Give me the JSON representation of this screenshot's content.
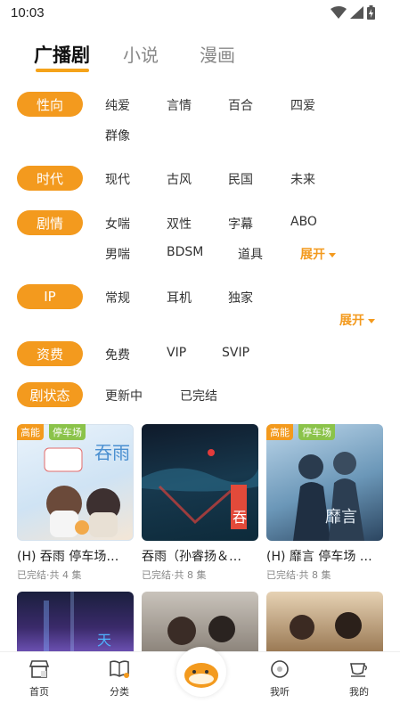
{
  "status": {
    "time": "10:03"
  },
  "tabs": [
    {
      "label": "广播剧"
    },
    {
      "label": "小说"
    },
    {
      "label": "漫画"
    }
  ],
  "filters": {
    "orientation": {
      "label": "性向",
      "options": [
        "纯爱",
        "言情",
        "百合",
        "四爱",
        "群像"
      ]
    },
    "era": {
      "label": "时代",
      "options": [
        "现代",
        "古风",
        "民国",
        "未来"
      ]
    },
    "plot": {
      "label": "剧情",
      "options": [
        "女喘",
        "双性",
        "字幕",
        "ABO",
        "男喘",
        "BDSM",
        "道具"
      ],
      "expand": "展开"
    },
    "ip": {
      "label": "IP",
      "options": [
        "常规",
        "耳机",
        "独家"
      ],
      "expand": "展开"
    },
    "fee": {
      "label": "资费",
      "options": [
        "免费",
        "VIP",
        "SVIP"
      ]
    },
    "status": {
      "label": "剧状态",
      "options": [
        "更新中",
        "已完结"
      ]
    }
  },
  "badges": {
    "high": "高能",
    "parking": "停车场"
  },
  "cards": [
    {
      "title": "(H) 吞雨 停车场…",
      "sub": "已完结·共 4 集"
    },
    {
      "title": "吞雨（孙睿扬＆…",
      "sub": "已完结·共 8 集"
    },
    {
      "title": "(H) 靡言 停车场 …",
      "sub": "已完结·共 8 集"
    }
  ],
  "nav": [
    {
      "label": "首页"
    },
    {
      "label": "分类"
    },
    {
      "label": "我听"
    },
    {
      "label": "我的"
    }
  ],
  "colors": {
    "accent": "#f39a1e",
    "parking_badge": "#8bc34a"
  }
}
